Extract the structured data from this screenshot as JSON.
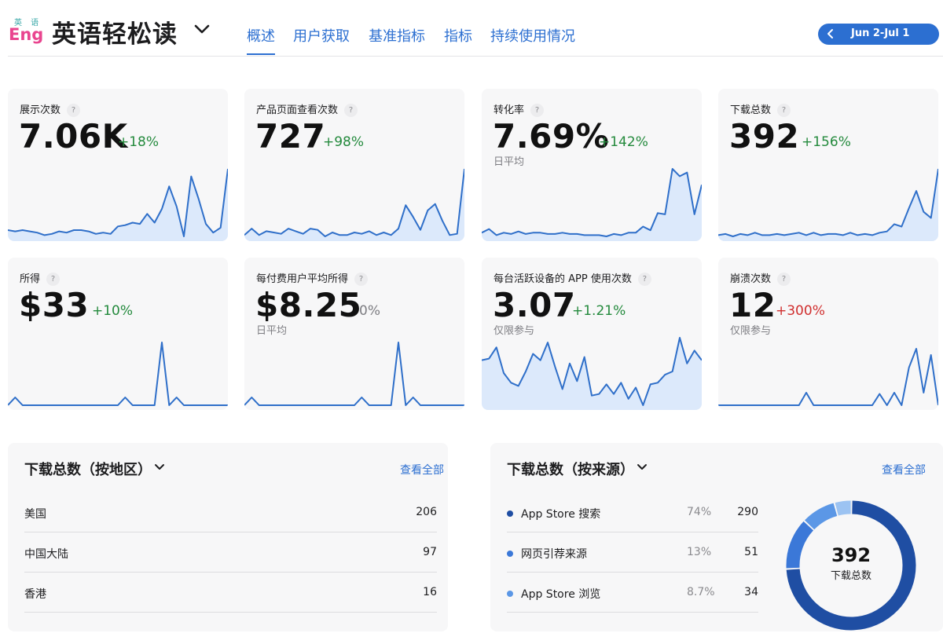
{
  "app": {
    "logo_top": "英 语",
    "logo_bottom": "Eng",
    "title": "英语轻松读",
    "accent_color": "#2c6fd1"
  },
  "tabs": [
    {
      "label": "概述",
      "active": true
    },
    {
      "label": "用户获取",
      "active": false
    },
    {
      "label": "基准指标",
      "active": false
    },
    {
      "label": "指标",
      "active": false
    },
    {
      "label": "持续使用情况",
      "active": false
    }
  ],
  "date_range": "Jun 2-Jul 1",
  "metrics": [
    {
      "label": "展示次数",
      "value": "7.06K",
      "change": "+18%",
      "trend": "up",
      "sub": "",
      "fill": true,
      "spark": [
        7,
        6,
        7,
        6,
        5,
        3,
        4,
        6,
        5,
        7,
        7,
        6,
        4,
        5,
        4,
        10,
        11,
        13,
        12,
        20,
        13,
        24,
        42,
        26,
        2,
        50,
        32,
        12,
        5,
        9,
        56
      ]
    },
    {
      "label": "产品页面查看次数",
      "value": "727",
      "change": "+98%",
      "trend": "up",
      "sub": "",
      "fill": true,
      "spark": [
        3,
        8,
        3,
        6,
        5,
        4,
        8,
        6,
        4,
        8,
        7,
        2,
        5,
        3,
        3,
        5,
        4,
        6,
        3,
        5,
        3,
        8,
        26,
        17,
        7,
        22,
        27,
        14,
        3,
        4,
        54
      ]
    },
    {
      "label": "转化率",
      "value": "7.69%",
      "change": "+142%",
      "trend": "up",
      "sub": "日平均",
      "fill": true,
      "spark": [
        5,
        8,
        3,
        5,
        4,
        6,
        4,
        5,
        5,
        4,
        4,
        5,
        4,
        4,
        3,
        3,
        3,
        2,
        4,
        3,
        5,
        5,
        10,
        7,
        21,
        20,
        57,
        51,
        54,
        20,
        44
      ]
    },
    {
      "label": "下载总数",
      "value": "392",
      "change": "+156%",
      "trend": "up",
      "sub": "",
      "fill": true,
      "spark": [
        3,
        4,
        2,
        4,
        3,
        5,
        3,
        3,
        4,
        3,
        4,
        5,
        3,
        5,
        3,
        4,
        4,
        3,
        5,
        3,
        4,
        3,
        5,
        6,
        12,
        10,
        25,
        39,
        22,
        17,
        57
      ]
    },
    {
      "label": "所得",
      "value": "$33",
      "change": "+10%",
      "trend": "up",
      "sub": "",
      "fill": false,
      "spark": [
        0,
        4,
        0,
        0,
        0,
        0,
        0,
        0,
        0,
        0,
        0,
        0,
        0,
        0,
        0,
        0,
        4,
        0,
        0,
        0,
        0,
        32,
        0,
        4,
        0,
        0,
        0,
        0,
        0,
        0,
        0
      ]
    },
    {
      "label": "每付费用户平均所得",
      "value": "$8.25",
      "change": "0%",
      "trend": "neutral",
      "sub": "日平均",
      "fill": false,
      "spark": [
        0,
        4,
        0,
        0,
        0,
        0,
        0,
        0,
        0,
        0,
        0,
        0,
        0,
        0,
        0,
        0,
        4,
        0,
        0,
        0,
        0,
        32,
        0,
        4,
        0,
        0,
        0,
        0,
        0,
        0,
        0
      ]
    },
    {
      "label": "每台活跃设备的 APP 使用次数",
      "value": "3.07",
      "change": "+1.21%",
      "trend": "up",
      "sub": "仅限参与",
      "fill": true,
      "spark": [
        3.0,
        3.01,
        3.08,
        2.92,
        2.86,
        2.84,
        2.93,
        3.04,
        3.0,
        3.11,
        2.96,
        2.82,
        2.98,
        2.87,
        3.02,
        2.78,
        2.79,
        2.85,
        2.79,
        2.86,
        2.76,
        2.83,
        2.72,
        2.85,
        2.86,
        2.91,
        2.93,
        3.14,
        2.98,
        3.06,
        3.0
      ]
    },
    {
      "label": "崩溃次数",
      "value": "12",
      "change": "+300%",
      "trend": "down",
      "sub": "仅限参与",
      "fill": false,
      "spark": [
        0,
        0,
        0,
        0,
        0,
        0,
        0,
        0,
        0,
        0,
        0,
        0,
        0,
        0,
        0,
        0,
        0,
        0,
        0,
        0,
        0,
        0,
        0,
        0,
        0,
        0,
        0,
        0,
        0,
        0,
        0
      ]
    }
  ],
  "crash_spark": [
    0,
    0,
    0,
    0,
    0,
    0,
    0,
    0,
    0,
    0,
    0,
    0,
    1,
    0,
    0,
    0,
    0,
    0,
    0,
    0,
    0,
    0,
    0,
    0,
    1,
    0,
    0,
    1,
    0,
    0,
    0
  ],
  "regions": {
    "title": "下载总数（按地区）",
    "view_all": "查看全部",
    "rows": [
      {
        "name": "美国",
        "value": "206"
      },
      {
        "name": "中国大陆",
        "value": "97"
      },
      {
        "name": "香港",
        "value": "16"
      }
    ]
  },
  "sources": {
    "title": "下载总数（按来源）",
    "view_all": "查看全部",
    "total": "392",
    "total_label": "下载总数",
    "rows": [
      {
        "name": "App Store 搜索",
        "pct": "74%",
        "value": "290",
        "share": 0.74,
        "color": "#1f4ea3"
      },
      {
        "name": "网页引荐来源",
        "pct": "13%",
        "value": "51",
        "share": 0.13,
        "color": "#3b78d8"
      },
      {
        "name": "App Store 浏览",
        "pct": "8.7%",
        "value": "34",
        "share": 0.087,
        "color": "#5b97e6"
      }
    ],
    "other_share": 0.043,
    "other_color": "#9cc3f2"
  }
}
